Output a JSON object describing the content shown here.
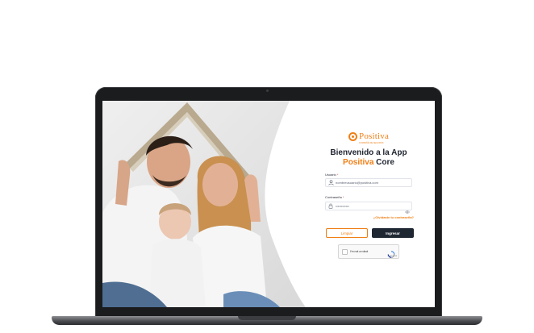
{
  "app": {
    "logo_text": "Positiva",
    "logo_tagline": "COMPAÑÍA DE SEGUROS"
  },
  "login": {
    "welcome_line1": "Bienvenido a la App",
    "welcome_brand": "Positiva",
    "welcome_core": "Core",
    "user_label": "Usuario",
    "user_value": "nombreusuario@positiva.com",
    "password_label": "Contraseña",
    "password_value": "••••••••••••",
    "required_mark": "*",
    "forgot_link": "¿Olvidaste tu contraseña?",
    "clear_button": "Limpiar",
    "submit_button": "Ingresar",
    "captcha_label": "I'm not a robot",
    "captcha_fine": "reCAPTCHA"
  },
  "colors": {
    "brand_orange": "#f07e14",
    "dark_navy": "#1f2733",
    "laptop_bezel": "#1b1c1e"
  },
  "icons": {
    "user_field": "user-icon",
    "password_field": "lock-icon",
    "show_password": "eye-icon",
    "captcha": "recaptcha-icon"
  }
}
